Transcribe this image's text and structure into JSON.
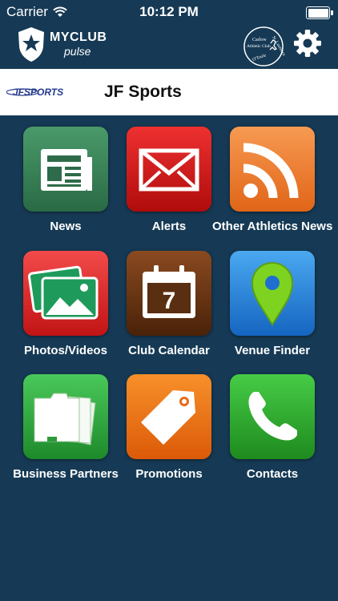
{
  "status_bar": {
    "carrier": "Carrier",
    "time": "10:12 PM"
  },
  "header": {
    "logo_main": "MYCLUB",
    "logo_sub": "pulse",
    "club_badge_text": [
      "St. Laurence",
      "Carlow",
      "Athletic Club",
      "O'Toole"
    ]
  },
  "brand": {
    "logo_text": "JFSPORTS",
    "name": "JF Sports"
  },
  "menu": [
    {
      "label": "News"
    },
    {
      "label": "Alerts"
    },
    {
      "label": "Other Athletics News"
    },
    {
      "label": "Photos/Videos"
    },
    {
      "label": "Club Calendar",
      "calendar_day": "7"
    },
    {
      "label": "Venue Finder"
    },
    {
      "label": "Business Partners"
    },
    {
      "label": "Promotions"
    },
    {
      "label": "Contacts"
    }
  ],
  "colors": {
    "background": "#163a55",
    "news": "#2e7d4f",
    "alerts": "#d11a1a",
    "rss": "#f07a2a",
    "photos": "#e02020",
    "calendar": "#6a3a1a",
    "venue": "#1e88e5",
    "partners": "#2eaa3a",
    "promotions": "#f06a12",
    "contacts": "#2eaa2a"
  }
}
